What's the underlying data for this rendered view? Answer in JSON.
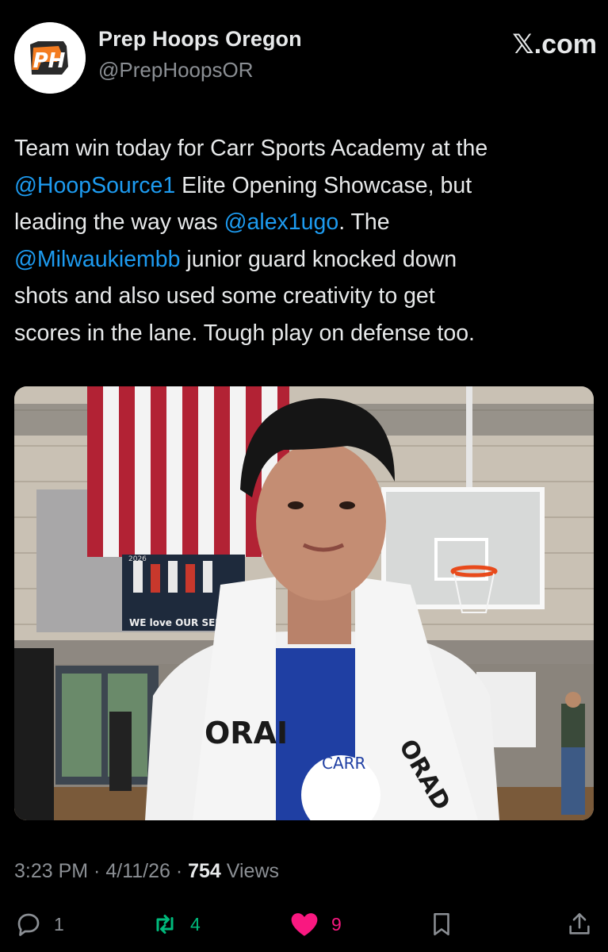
{
  "author": {
    "display_name": "Prep Hoops Oregon",
    "handle": "@PrepHoopsOR",
    "avatar_text": "PH"
  },
  "brand": "𝕏.com",
  "tweet": {
    "lines": [
      [
        {
          "t": "Team win today for Carr Sports Academy at the",
          "m": false
        }
      ],
      [
        {
          "t": "@HoopSource1",
          "m": true
        },
        {
          "t": " Elite Opening Showcase, but",
          "m": false
        }
      ],
      [
        {
          "t": "leading the way was ",
          "m": false
        },
        {
          "t": "@alex1ugo",
          "m": true
        },
        {
          "t": ". The",
          "m": false
        }
      ],
      [
        {
          "t": "@Milwaukiembb",
          "m": true
        },
        {
          "t": " junior guard knocked down",
          "m": false
        }
      ],
      [
        {
          "t": "shots and also used some creativity to get",
          "m": false
        }
      ],
      [
        {
          "t": "scores in the lane. Tough play on defense too.",
          "m": false
        }
      ]
    ]
  },
  "photo": {
    "banner_text": "WE love OUR SENIORS",
    "banner_year": "2026",
    "towel_text_left": "ORAI",
    "towel_text_right": "ORAD",
    "jersey_text": "CARR"
  },
  "meta": {
    "time": "3:23 PM",
    "sep1": " · ",
    "date": "4/11/26",
    "sep2": " · ",
    "views_count": "754",
    "views_label": " Views"
  },
  "actions": {
    "reply_count": "1",
    "repost_count": "4",
    "like_count": "9"
  },
  "colors": {
    "background": "#000000",
    "mention": "#1d9bf0",
    "repost": "#00ba7c",
    "like": "#f91880",
    "secondary_text": "#8b8f94"
  }
}
